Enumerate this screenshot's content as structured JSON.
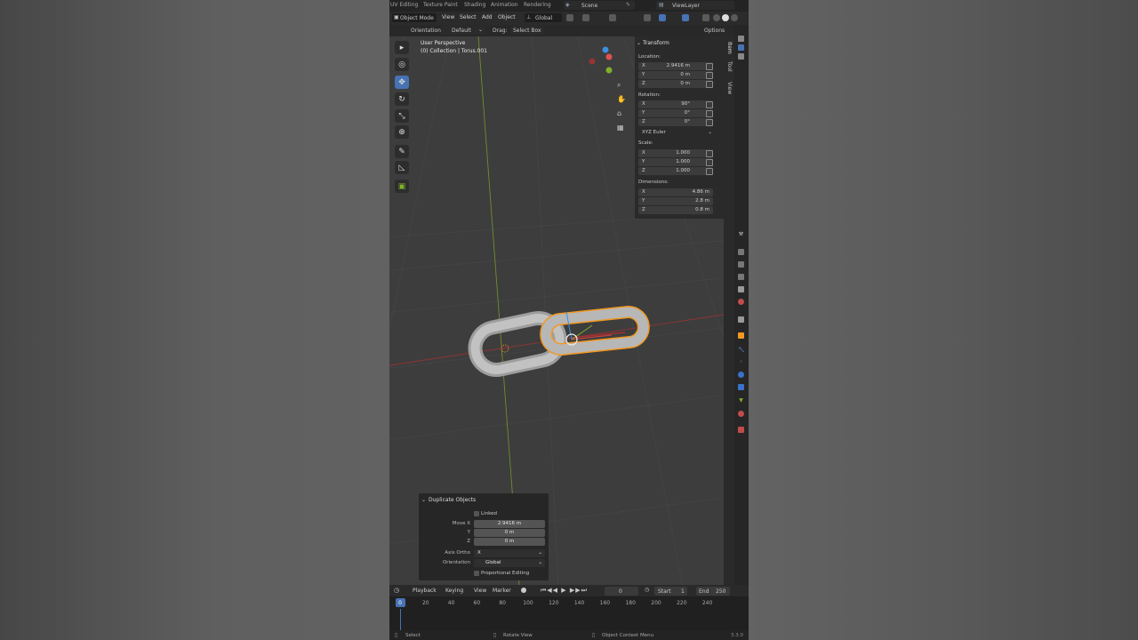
{
  "topbar": {
    "workspace_tabs": [
      "UV Editing",
      "Texture Paint",
      "Shading",
      "Animation",
      "Rendering"
    ],
    "scene": "Scene",
    "view_layer": "ViewLayer"
  },
  "header": {
    "mode": "Object Mode",
    "menus": [
      "View",
      "Select",
      "Add",
      "Object"
    ],
    "transform_orientation": "Global"
  },
  "tool_header": {
    "orientation_label": "Orientation:",
    "orientation_value": "Default",
    "drag_label": "Drag:",
    "drag_value": "Select Box",
    "options_label": "Options"
  },
  "viewport": {
    "view_name": "User Perspective",
    "collection_info": "(0) Collection | Torus.001"
  },
  "n_panel": {
    "tabs": [
      "Item",
      "Tool",
      "View"
    ],
    "section": "Transform",
    "location_label": "Location:",
    "location": [
      {
        "axis": "X",
        "value": "2.9416 m"
      },
      {
        "axis": "Y",
        "value": "0 m"
      },
      {
        "axis": "Z",
        "value": "0 m"
      }
    ],
    "rotation_label": "Rotation:",
    "rotation": [
      {
        "axis": "X",
        "value": "90°"
      },
      {
        "axis": "Y",
        "value": "0°"
      },
      {
        "axis": "Z",
        "value": "0°"
      }
    ],
    "rotation_mode": "XYZ Euler",
    "scale_label": "Scale:",
    "scale": [
      {
        "axis": "X",
        "value": "1.000"
      },
      {
        "axis": "Y",
        "value": "1.000"
      },
      {
        "axis": "Z",
        "value": "1.000"
      }
    ],
    "dimensions_label": "Dimensions:",
    "dimensions": [
      {
        "axis": "X",
        "value": "4.86 m"
      },
      {
        "axis": "Y",
        "value": "2.8 m"
      },
      {
        "axis": "Z",
        "value": "0.8 m"
      }
    ]
  },
  "redo_panel": {
    "title": "Duplicate Objects",
    "linked_label": "Linked",
    "linked_checked": false,
    "move_x_label": "Move X",
    "move_x": "2.9416 m",
    "move_y_label": "Y",
    "move_y": "0 m",
    "move_z_label": "Z",
    "move_z": "0 m",
    "axis_ortho_label": "Axis Ortho",
    "axis_ortho": "X",
    "orientation_label": "Orientation",
    "orientation": "Global",
    "proportional_label": "Proportional Editing",
    "proportional_checked": false
  },
  "timeline": {
    "menus": [
      "Playback",
      "Keying",
      "View",
      "Marker"
    ],
    "current_frame": "0",
    "start_label": "Start",
    "start": "1",
    "end_label": "End",
    "end": "250",
    "ruler": [
      "0",
      "20",
      "40",
      "60",
      "80",
      "100",
      "120",
      "140",
      "160",
      "180",
      "200",
      "220",
      "240"
    ]
  },
  "statusbar": {
    "select": "Select",
    "rotate_view": "Rotate View",
    "context_menu": "Object Context Menu",
    "version": "3.3.0"
  },
  "colors": {
    "accent": "#4772b3",
    "selection_outline": "#f29822",
    "axis_x": "#d24545",
    "axis_y": "#7fb12a",
    "axis_z": "#3d8fdb",
    "viewport_bg": "#3d3d3d"
  }
}
